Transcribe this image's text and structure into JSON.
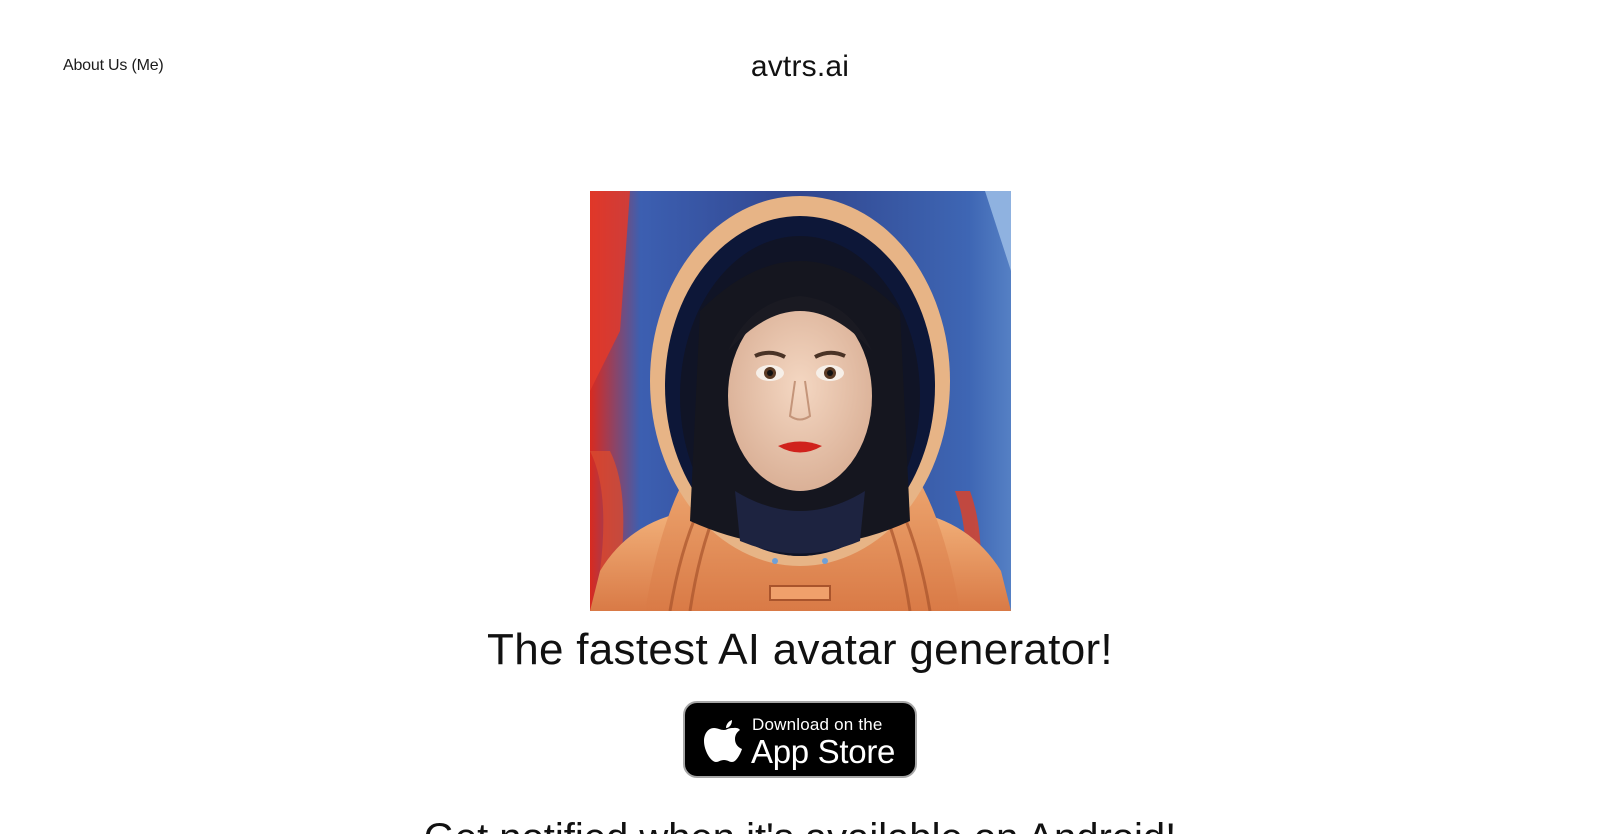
{
  "header": {
    "about_link": "About Us (Me)",
    "site_title": "avtrs.ai"
  },
  "hero": {
    "image_subject": "avatar-portrait-astronaut",
    "headline": "The fastest AI avatar generator!"
  },
  "app_store_badge": {
    "small_text": "Download on the",
    "big_text": "App Store",
    "icon": "apple-logo-icon",
    "background_color": "#000000",
    "border_color": "#a6a6a6"
  },
  "footer_teaser": {
    "text": "Get notified when it's available on Android!"
  }
}
